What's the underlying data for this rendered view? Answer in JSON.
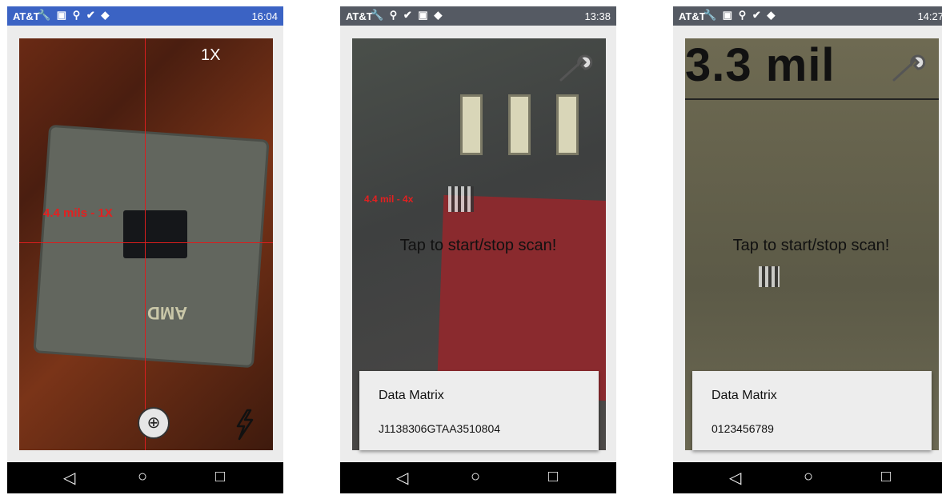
{
  "screens": [
    {
      "status": {
        "carrier": "AT&T",
        "time": "16:04"
      },
      "zoom_label": "1X",
      "measurement": "4.4 mils - 1X"
    },
    {
      "status": {
        "carrier": "AT&T",
        "time": "13:38"
      },
      "measurement": "4.4 mil - 4x",
      "hint": "Tap to start/stop scan!",
      "result": {
        "type": "Data Matrix",
        "value": "J1138306GTAA3510804"
      }
    },
    {
      "status": {
        "carrier": "AT&T",
        "time": "14:27"
      },
      "overlay_text": "3.3 mil",
      "hint": "Tap to start/stop scan!",
      "result": {
        "type": "Data Matrix",
        "value": "0123456789"
      }
    }
  ],
  "chip_label": "AMD",
  "colors": {
    "statusbar": "#3b63c4",
    "measure": "#e32020"
  },
  "icons": {
    "nav": [
      "back-icon",
      "home-icon",
      "recents-icon"
    ]
  }
}
